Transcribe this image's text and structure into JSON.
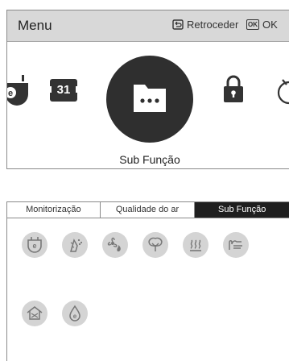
{
  "menu": {
    "title": "Menu",
    "back_label": "Retroceder",
    "ok_key": "OK",
    "ok_label": "OK",
    "calendar_day": "31",
    "selected_label": "Sub Função"
  },
  "tabs": [
    {
      "label": "Monitorização",
      "active": false
    },
    {
      "label": "Qualidade do ar",
      "active": false
    },
    {
      "label": "Sub Função",
      "active": true
    }
  ],
  "grid_icons": [
    "plug-energy-icon",
    "plant-care-icon",
    "fan-heater-icon",
    "filter-tree-icon",
    "heat-waves-icon",
    "hand-dry-icon",
    "house-air-icon",
    "drop-energy-icon"
  ],
  "colors": {
    "header_bg": "#d8d8d8",
    "selected_circle": "#2f2f2f",
    "active_tab": "#1f1f1f",
    "grid_icon_bg": "#d4d4d4"
  }
}
